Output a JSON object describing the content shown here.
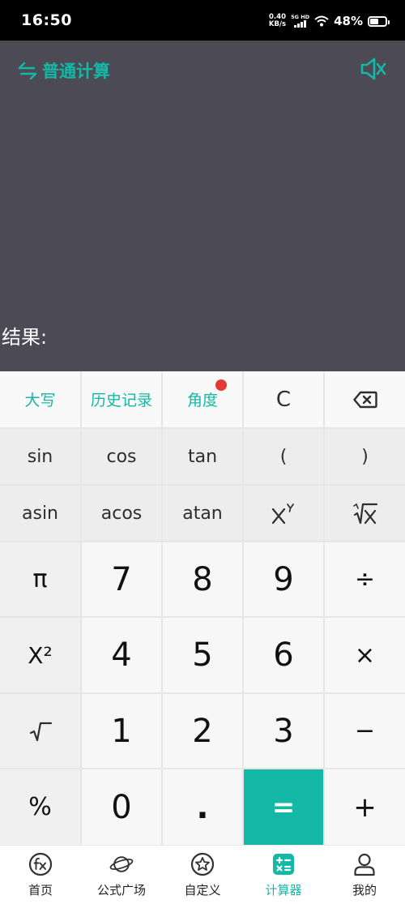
{
  "status_bar": {
    "time": "16:50",
    "net_speed_value": "0.40",
    "net_speed_unit": "KB/s",
    "signal_label": "5G HD",
    "battery_percent": "48%"
  },
  "display": {
    "mode_label": "普通计算",
    "result_label": "结果:",
    "accent_color": "#14b8a6"
  },
  "keypad": {
    "row_top": [
      "大写",
      "历史记录",
      "角度",
      "C"
    ],
    "row_trig": [
      "sin",
      "cos",
      "tan",
      "(",
      ")"
    ],
    "row_inv": [
      "asin",
      "acos",
      "atan"
    ],
    "digits": {
      "seven": "7",
      "eight": "8",
      "nine": "9",
      "four": "4",
      "five": "5",
      "six": "6",
      "one": "1",
      "two": "2",
      "three": "3",
      "zero": "0",
      "dot": "."
    },
    "ops": {
      "pi": "π",
      "square": "X²",
      "percent": "%",
      "divide": "÷",
      "multiply": "×",
      "minus": "−",
      "plus": "+",
      "equals": "="
    }
  },
  "tabbar": {
    "tabs": [
      "首页",
      "公式广场",
      "自定义",
      "计算器",
      "我的"
    ],
    "active_tab": "计算器"
  }
}
